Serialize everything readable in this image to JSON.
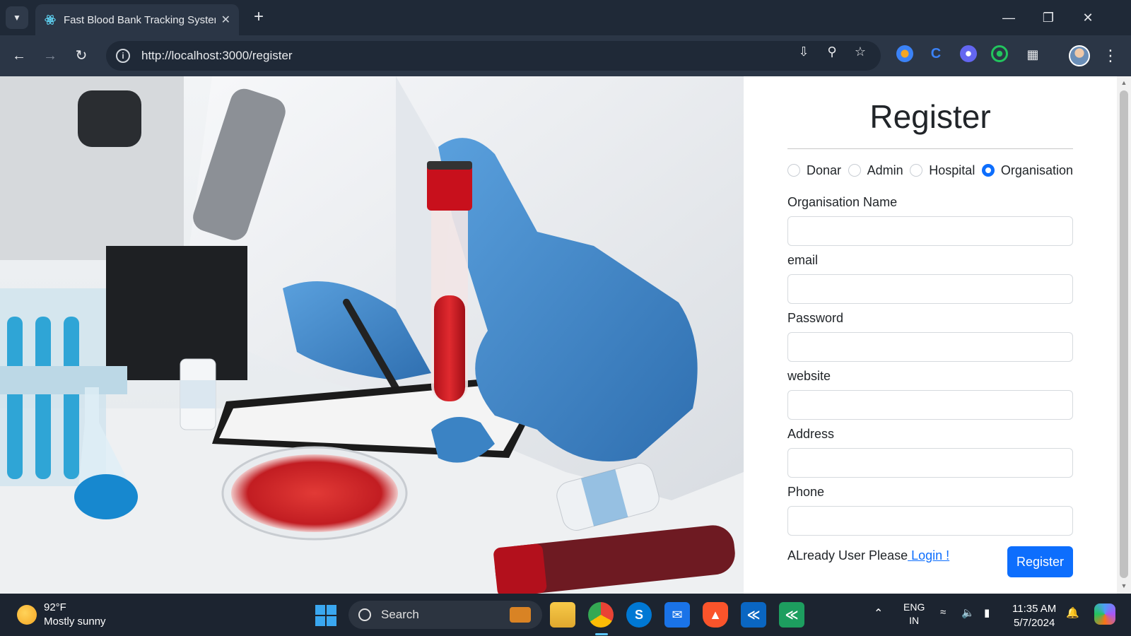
{
  "browser": {
    "tab_title": "Fast Blood Bank Tracking System",
    "url": "http://localhost:3000/register"
  },
  "form": {
    "title": "Register",
    "roles": [
      {
        "label": "Donar",
        "checked": false
      },
      {
        "label": "Admin",
        "checked": false
      },
      {
        "label": "Hospital",
        "checked": false
      },
      {
        "label": "Organisation",
        "checked": true
      }
    ],
    "fields": [
      {
        "label": "Organisation Name",
        "value": ""
      },
      {
        "label": "email",
        "value": ""
      },
      {
        "label": "Password",
        "value": ""
      },
      {
        "label": "website",
        "value": ""
      },
      {
        "label": "Address",
        "value": ""
      },
      {
        "label": "Phone",
        "value": ""
      }
    ],
    "login_prefix": "ALready User Please",
    "login_link": "Login !",
    "submit_label": "Register"
  },
  "taskbar": {
    "temperature": "92°F",
    "weather": "Mostly sunny",
    "search_placeholder": "Search",
    "lang_top": "ENG",
    "lang_bottom": "IN",
    "time": "11:35 AM",
    "date": "5/7/2024"
  },
  "colors": {
    "accent": "#0d6efd",
    "chrome_dark": "#1f2937",
    "chrome_mid": "#2b3646"
  }
}
